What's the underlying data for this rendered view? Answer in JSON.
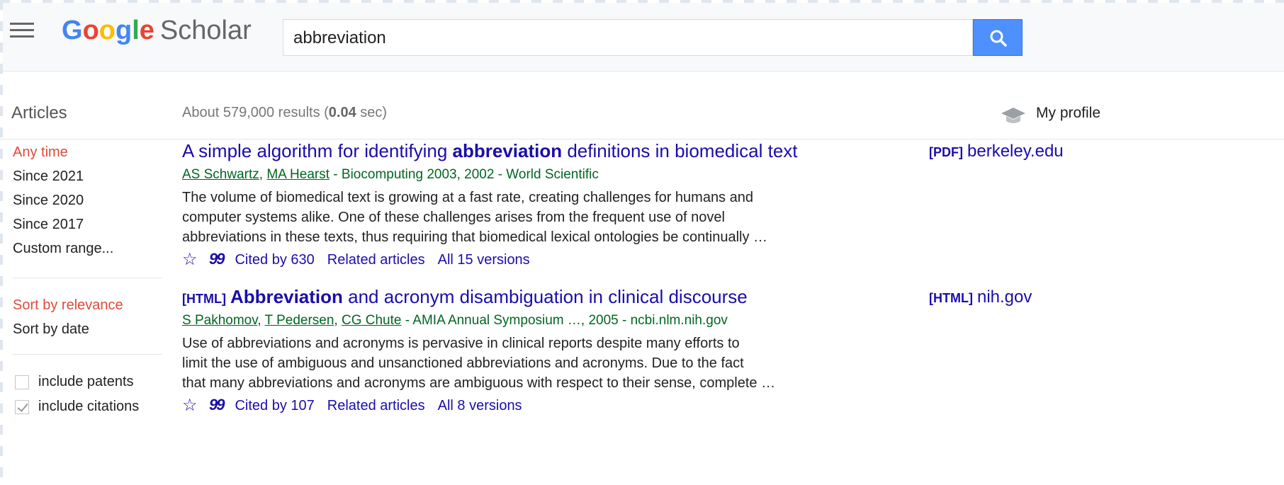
{
  "header": {
    "logo": {
      "g1": "G",
      "o1": "o",
      "o2": "o",
      "g2": "g",
      "l": "l",
      "e": "e",
      "scholar": "Scholar"
    },
    "search_value": "abbreviation",
    "search_icon": "search-icon"
  },
  "subheader": {
    "articles": "Articles",
    "results_prefix": "About 579,000 results (",
    "results_time": "0.04",
    "results_suffix": " sec)",
    "profile": "My profile",
    "profile_icon": "graduation-cap-icon"
  },
  "sidebar": {
    "time_filters": [
      "Any time",
      "Since 2021",
      "Since 2020",
      "Since 2017",
      "Custom range..."
    ],
    "sort_options": [
      "Sort by relevance",
      "Sort by date"
    ],
    "checkboxes": [
      {
        "label": "include patents",
        "checked": false
      },
      {
        "label": "include citations",
        "checked": true
      }
    ]
  },
  "results": [
    {
      "tag": "",
      "title_before": "A simple algorithm for identifying ",
      "title_bold": "abbreviation",
      "title_after": " definitions in biomedical text",
      "authors": [
        "AS Schwartz",
        "MA Hearst"
      ],
      "source": " - Biocomputing 2003, 2002 - World Scientific",
      "snippet": [
        "The volume of biomedical text is growing at a fast rate, creating challenges for humans and",
        "computer systems alike. One of these challenges arises from the frequent use of novel",
        "abbreviations in these texts, thus requiring that biomedical lexical ontologies be continually …"
      ],
      "cited_by": "Cited by 630",
      "related": "Related articles",
      "versions": "All 15 versions",
      "side_tag": "[PDF]",
      "side_link": "berkeley.edu"
    },
    {
      "tag": "[HTML]",
      "title_before": "",
      "title_bold": "Abbreviation",
      "title_after": " and acronym disambiguation in clinical discourse",
      "authors": [
        "S Pakhomov",
        "T Pedersen",
        "CG Chute"
      ],
      "source": " - AMIA Annual Symposium …, 2005 - ncbi.nlm.nih.gov",
      "snippet": [
        "Use of abbreviations and acronyms is pervasive in clinical reports despite many efforts to",
        "limit the use of ambiguous and unsanctioned abbreviations and acronyms. Due to the fact",
        "that many abbreviations and acronyms are ambiguous with respect to their sense, complete …"
      ],
      "cited_by": "Cited by 107",
      "related": "Related articles",
      "versions": "All 8 versions",
      "side_tag": "[HTML]",
      "side_link": "nih.gov"
    }
  ],
  "icons": {
    "star": "☆",
    "cite": "99",
    "menu": "hamburger-menu-icon"
  },
  "colors": {
    "link": "#1a0dab",
    "author_green": "#006621",
    "active_red": "#dd4b39",
    "search_blue": "#4d90fe"
  }
}
